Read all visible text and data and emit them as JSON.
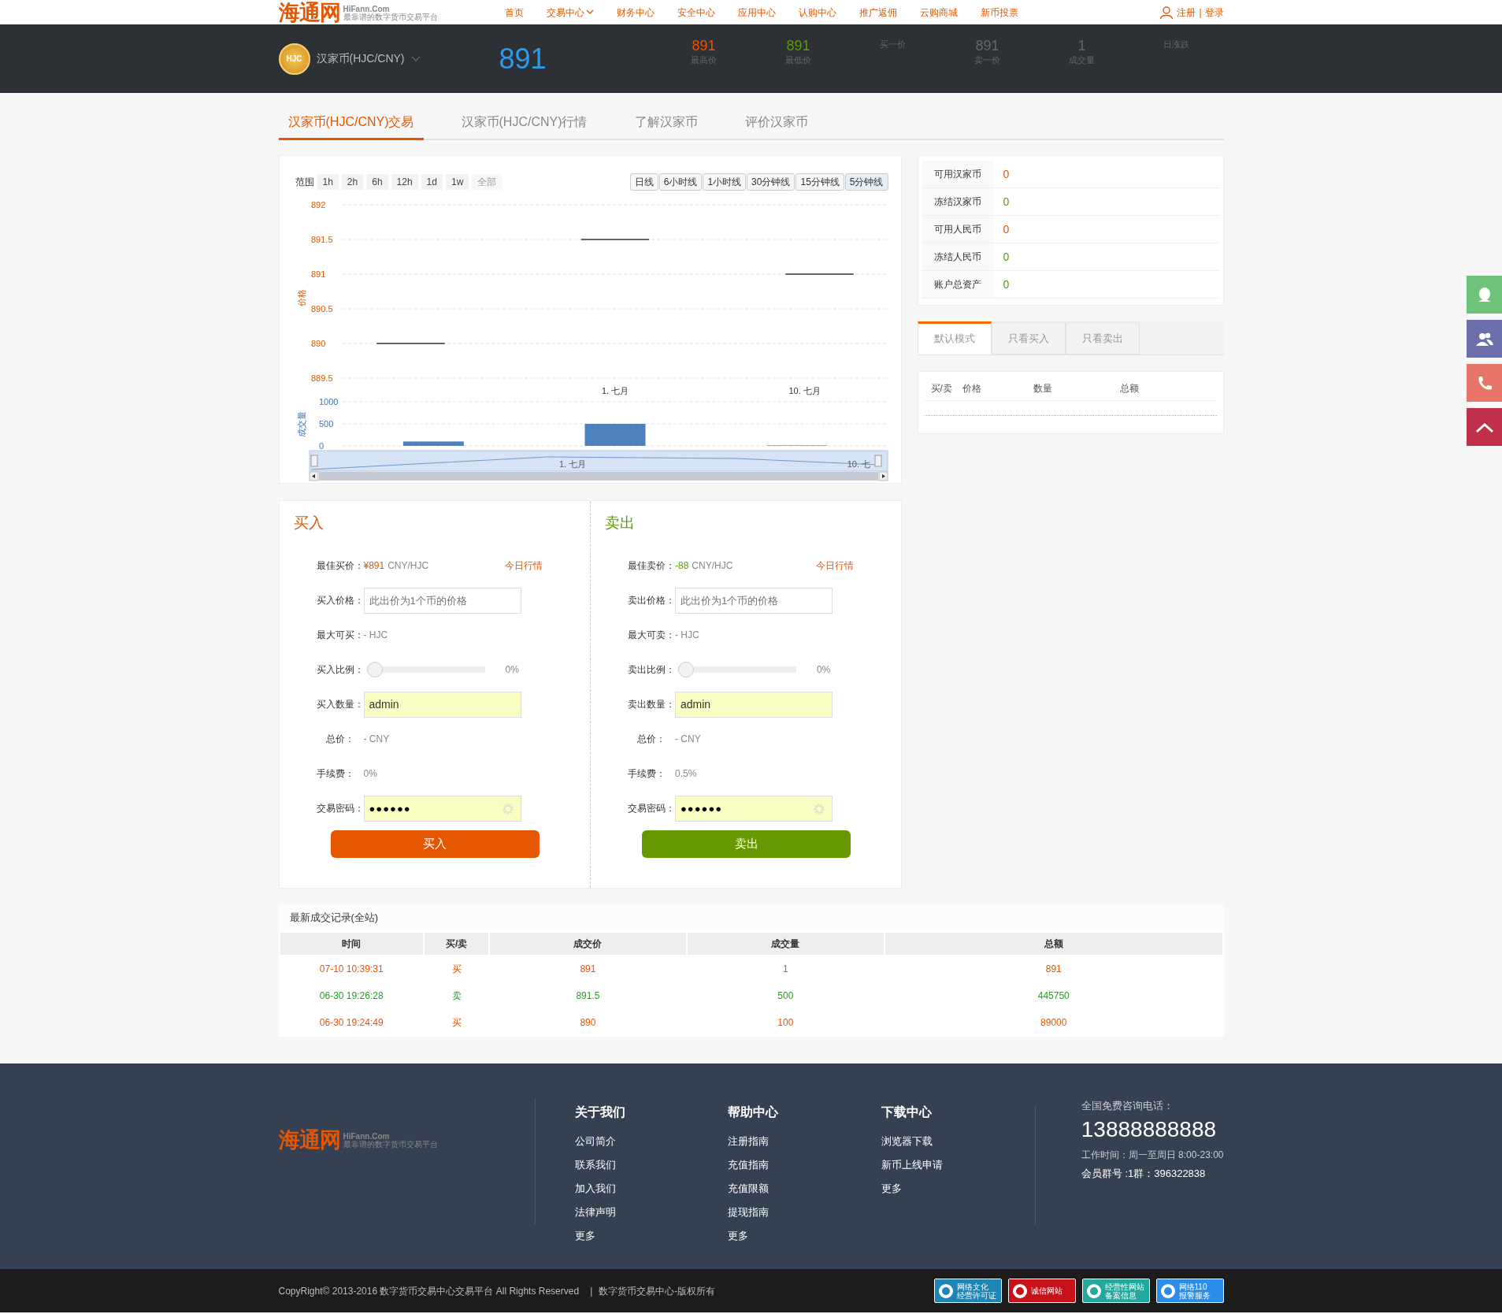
{
  "brand": {
    "logo": "海通网",
    "domain": "HiFann.Com",
    "slogan": "最靠谱的数字货币交易平台"
  },
  "nav": [
    {
      "label": "首页",
      "dropdown": false
    },
    {
      "label": "交易中心",
      "dropdown": true
    },
    {
      "label": "财务中心",
      "dropdown": false
    },
    {
      "label": "安全中心",
      "dropdown": false
    },
    {
      "label": "应用中心",
      "dropdown": false
    },
    {
      "label": "认购中心",
      "dropdown": false
    },
    {
      "label": "推广返佣",
      "dropdown": false
    },
    {
      "label": "云购商城",
      "dropdown": false
    },
    {
      "label": "新币投票",
      "dropdown": false
    }
  ],
  "account": {
    "register": "注册",
    "separator": "|",
    "login": "登录"
  },
  "ticker": {
    "coin_badge": "HJC",
    "pair": "汉家币(HJC/CNY)",
    "last_price": "891",
    "stats": [
      {
        "value": "891",
        "label": "最高价",
        "color": "#e55600"
      },
      {
        "value": "891",
        "label": "最低价",
        "color": "#5c9a0a"
      },
      {
        "label": "买一价"
      },
      {
        "value": "891",
        "label": "卖一价",
        "color": "#666666"
      },
      {
        "value": "1",
        "label": "成交量",
        "color": "#666666"
      },
      {
        "label": "日涨跌"
      }
    ]
  },
  "tabs": [
    {
      "label": "汉家币(HJC/CNY)交易",
      "selected": true
    },
    {
      "label": "汉家币(HJC/CNY)行情",
      "selected": false
    },
    {
      "label": "了解汉家币",
      "selected": false
    },
    {
      "label": "评价汉家币",
      "selected": false
    }
  ],
  "chart": {
    "range_label": "范围",
    "ranges": [
      {
        "label": "1h",
        "disabled": false
      },
      {
        "label": "2h",
        "disabled": false
      },
      {
        "label": "6h",
        "disabled": false
      },
      {
        "label": "12h",
        "disabled": false
      },
      {
        "label": "1d",
        "disabled": false
      },
      {
        "label": "1w",
        "disabled": false
      },
      {
        "label": "全部",
        "disabled": true
      }
    ],
    "periods": [
      {
        "label": "日线",
        "selected": false
      },
      {
        "label": "6小时线",
        "selected": false
      },
      {
        "label": "1小时线",
        "selected": false
      },
      {
        "label": "30分钟线",
        "selected": false
      },
      {
        "label": "15分钟线",
        "selected": false
      },
      {
        "label": "5分钟线",
        "selected": true
      }
    ],
    "price_chart": {
      "chart_data": {
        "type": "line",
        "ylabel": "价格",
        "grid": true,
        "categories": [
          null,
          null,
          null,
          null,
          null,
          null,
          null,
          null
        ],
        "ylim": [
          889.5,
          892
        ],
        "yticks": [
          889.5,
          890,
          890.5,
          891,
          891.5,
          892
        ],
        "series": [
          {
            "color": "#333333",
            "values": [
              890,
              890,
              null,
              null,
              null,
              null,
              null,
              null
            ]
          },
          {
            "color": "#333333",
            "values": [
              null,
              null,
              null,
              891.5,
              891.5,
              null,
              null,
              null
            ]
          },
          {
            "color": "#333333",
            "values": [
              null,
              null,
              null,
              null,
              null,
              null,
              891,
              891
            ]
          }
        ]
      }
    },
    "x_labels": [
      "1. 七月",
      "10. 七月"
    ],
    "volume_chart": {
      "chart_data": {
        "type": "bar",
        "ylabel": "成交量",
        "grid": true,
        "ylim": [
          0,
          1000
        ],
        "yticks": [
          0,
          500,
          1000
        ],
        "series": [
          {
            "color": "#4f81bd",
            "values": [
              100,
              500,
              0
            ]
          }
        ]
      }
    },
    "navigator_labels": [
      "1. 七月",
      "10. 七"
    ]
  },
  "assets": [
    {
      "label": "可用汉家币",
      "value": "0",
      "color": "#e55600"
    },
    {
      "label": "冻结汉家币",
      "value": "0",
      "color": "#5c9a0a"
    },
    {
      "label": "可用人民币",
      "value": "0",
      "color": "#e55600"
    },
    {
      "label": "冻结人民币",
      "value": "0",
      "color": "#5c9a0a"
    },
    {
      "label": "账户总资产",
      "value": "0",
      "color": "#5c9a0a"
    }
  ],
  "orderbook": {
    "modes": [
      {
        "label": "默认模式",
        "selected": true
      },
      {
        "label": "只看买入",
        "selected": false
      },
      {
        "label": "只看卖出",
        "selected": false
      }
    ],
    "columns": [
      "买/卖",
      "价格",
      "数量",
      "总额"
    ]
  },
  "trade_forms": [
    {
      "kind": "buy",
      "title": "买入",
      "best_label": "最佳买价：",
      "best_value": "¥891",
      "best_unit": "CNY/HJC",
      "market_link": "今日行情",
      "price_label": "买入价格：",
      "price_placeholder": "此出价为1个币的价格",
      "max_label": "最大可买：",
      "max_value": "- HJC",
      "ratio_label": "买入比例：",
      "ratio": {
        "level": 0
      },
      "ratio_text": "0%",
      "amount_label": "买入数量：",
      "amount_value": "admin",
      "total_label": "总价：",
      "total_value": "- CNY",
      "fee_label": "手续费：",
      "fee_value": "0%",
      "password_label": "交易密码：",
      "password_value": "●●●●●●",
      "submit": "买入"
    },
    {
      "kind": "sell",
      "title": "卖出",
      "best_label": "最佳卖价：",
      "best_value": "-88",
      "best_unit": "CNY/HJC",
      "market_link": "今日行情",
      "price_label": "卖出价格：",
      "price_placeholder": "此出价为1个币的价格",
      "max_label": "最大可卖：",
      "max_value": "- HJC",
      "ratio_label": "卖出比例：",
      "ratio": {
        "level": 0
      },
      "ratio_text": "0%",
      "amount_label": "卖出数量：",
      "amount_value": "admin",
      "total_label": "总价：",
      "total_value": "- CNY",
      "fee_label": "手续费：",
      "fee_value": "0.5%",
      "password_label": "交易密码：",
      "password_value": "●●●●●●",
      "submit": "卖出"
    }
  ],
  "trades": {
    "title": "最新成交记录(全站)",
    "columns": [
      "时间",
      "买/卖",
      "成交价",
      "成交量",
      "总额"
    ],
    "rows": [
      {
        "kind": "buy",
        "cells": [
          "07-10 10:39:31",
          "买",
          "891",
          "1",
          "891"
        ]
      },
      {
        "kind": "sell",
        "cells": [
          "06-30 19:26:28",
          "卖",
          "891.5",
          "500",
          "445750"
        ]
      },
      {
        "kind": "buy",
        "cells": [
          "06-30 19:24:49",
          "买",
          "890",
          "100",
          "89000"
        ]
      }
    ]
  },
  "footer": {
    "logo": "海通网",
    "domain": "HiFann.Com",
    "slogan": "最靠谱的数字货币交易平台",
    "columns": [
      {
        "title": "关于我们",
        "links": [
          "公司简介",
          "联系我们",
          "加入我们",
          "法律声明",
          "更多"
        ]
      },
      {
        "title": "帮助中心",
        "links": [
          "注册指南",
          "充值指南",
          "充值限额",
          "提现指南",
          "更多"
        ]
      },
      {
        "title": "下载中心",
        "links": [
          "浏览器下载",
          "新币上线申请",
          "更多"
        ]
      }
    ],
    "contact": {
      "label": "全国免费咨询电话：",
      "phone": "13888888888",
      "hours": "工作时间：周一至周日 8:00-23:00",
      "group": "会员群号 :1群：396322838"
    },
    "copyright": "CopyRight© 2013-2016 数字货币交易中心交易平台 All Rights Reserved",
    "separator": "|",
    "rights": "数字货币交易中心-版权所有",
    "badges": [
      {
        "lines": [
          "网络文化",
          "经营许可证"
        ],
        "color": "#1d86b5"
      },
      {
        "lines": [
          "诚信网站"
        ],
        "color": "#c8121b"
      },
      {
        "lines": [
          "经营性网站",
          "备案信息"
        ],
        "color": "#23a99c"
      },
      {
        "lines": [
          "网络110",
          "报警服务"
        ],
        "color": "#2a8de8"
      }
    ]
  }
}
